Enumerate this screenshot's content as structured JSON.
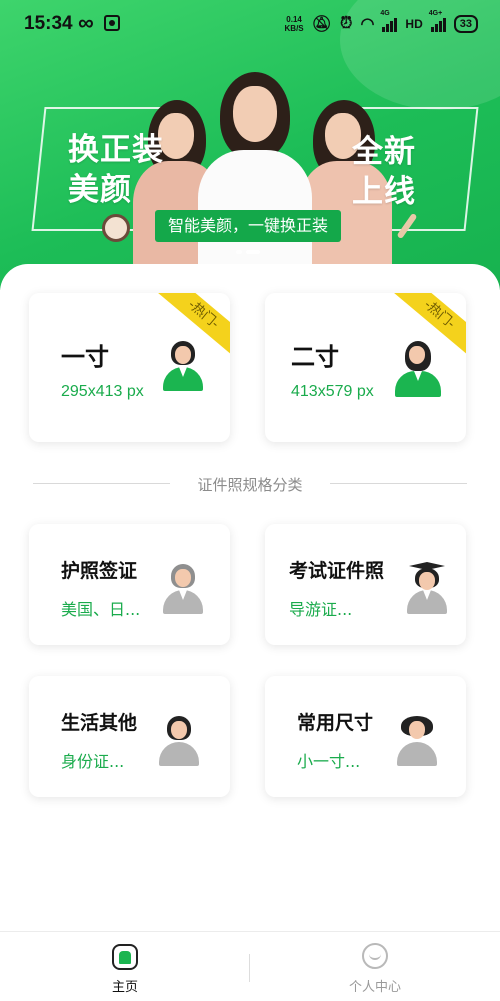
{
  "status_bar": {
    "time": "15:34",
    "loop_icon": "infinity-icon",
    "net_speed_value": "0.14",
    "net_speed_unit": "KB/S",
    "net_4g_1": "4G",
    "hd": "HD",
    "net_4g_2": "4G+",
    "battery": "33"
  },
  "banner": {
    "left_line1": "换正装",
    "left_line2": "美颜",
    "right_line1": "全新",
    "right_line2": "上线",
    "subtitle": "智能美颜，一键换正装",
    "slide_count": 2,
    "active_slide": 1
  },
  "top_cards": [
    {
      "title": "一寸",
      "size": "295x413 px",
      "badge": "-热门-"
    },
    {
      "title": "二寸",
      "size": "413x579 px",
      "badge": "-热门-"
    }
  ],
  "section_title": "证件照规格分类",
  "categories": [
    {
      "title": "护照签证",
      "subtitle": "美国、日..."
    },
    {
      "title": "考试证件照",
      "subtitle": "导游证..."
    },
    {
      "title": "生活其他",
      "subtitle": "身份证..."
    },
    {
      "title": "常用尺寸",
      "subtitle": "小一寸..."
    }
  ],
  "tabbar": {
    "home_label": "主页",
    "me_label": "个人中心"
  },
  "colors": {
    "brand_green": "#1dbd57",
    "accent_text_green": "#1aab4c",
    "hot_badge_yellow": "#f4d21c"
  }
}
